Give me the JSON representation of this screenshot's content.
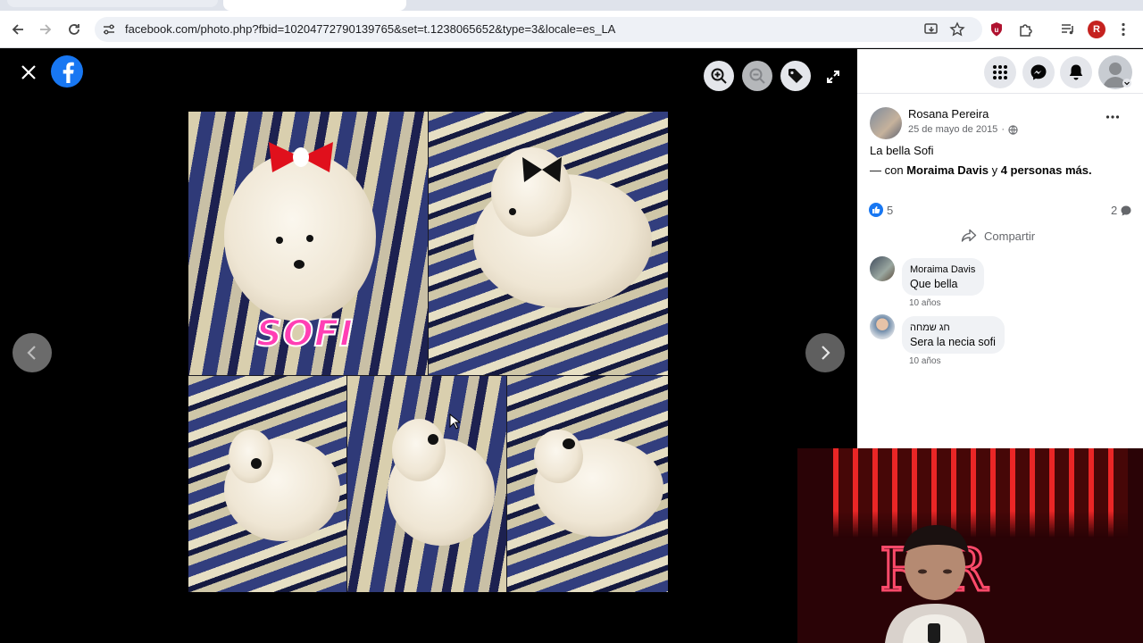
{
  "browser": {
    "url": "facebook.com/photo.php?fbid=10204772790139765&set=t.1238065652&type=3&locale=es_LA",
    "profile_initial": "R"
  },
  "viewer": {
    "photo_overlay_text": "SOFI"
  },
  "post": {
    "author": "Rosana Pereira",
    "date": "25 de mayo de 2015",
    "date_separator": "·",
    "caption": "La bella Sofi",
    "with_prefix": "— con ",
    "with_name": "Moraima Davis",
    "with_connector": " y ",
    "with_others": "4 personas más.",
    "like_count": "5",
    "comment_count": "2",
    "share_label": "Compartir"
  },
  "comments": [
    {
      "author": "Moraima Davis",
      "text": "Que bella",
      "time": "10 años"
    },
    {
      "author": "חג שמחה",
      "text": "Sera la necia sofi",
      "time": "10 años"
    }
  ],
  "colors": {
    "facebook_blue": "#1877f2",
    "overlay_pink": "#ff3fb4",
    "bow_red": "#e0101c"
  },
  "webcam": {
    "sign_letters": "R R"
  }
}
